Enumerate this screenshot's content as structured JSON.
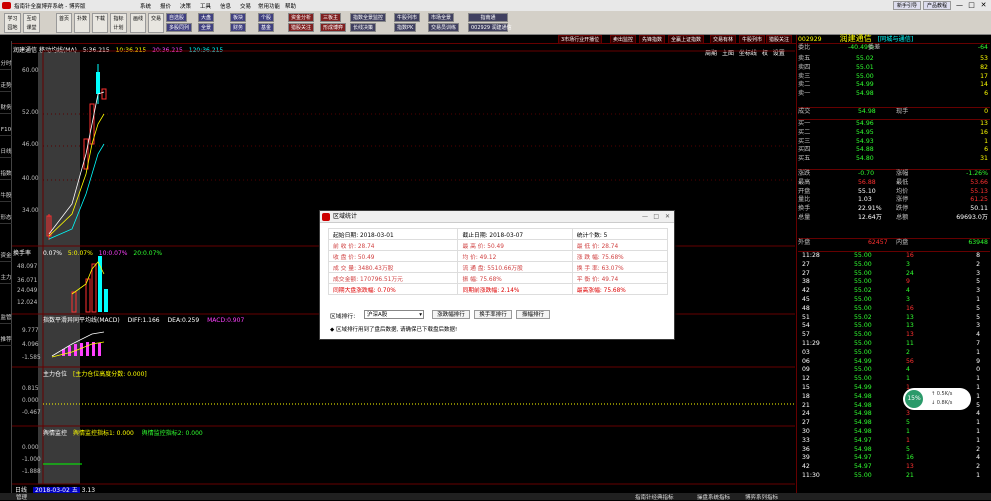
{
  "titlebar": {
    "app_title": "指南针全赢博弈系统 - 博弈版",
    "menus": [
      "系统",
      "报价",
      "决策",
      "工具",
      "信息",
      "交易",
      "常用功能",
      "帮助"
    ],
    "right_buttons": [
      "新手引导",
      "产品教程"
    ],
    "min": "—",
    "max": "□",
    "close": "✕"
  },
  "toolbar": {
    "big_buttons": [
      "学习\n园地",
      "互动\n课堂",
      "首页",
      "扑数",
      "下载",
      "指标\n计划",
      "画线",
      "交易"
    ],
    "mid_row1": [
      "自选股",
      "大盘",
      "板块",
      "个股",
      "资金分析",
      "三板主",
      "指数全景监控",
      "牛股列市",
      "市场全景",
      "指南通"
    ],
    "mid_row2": [
      "多股同列",
      "全景",
      "财务",
      "基金",
      "猎股关注",
      "形成博弈",
      "长线决策",
      "指数PK",
      "交易员训练",
      "002929 润建通信"
    ],
    "right_tabs": [
      "3市场行业开播位",
      "卖出监控",
      "先锋指数",
      "全赢上证指数",
      "交易有林",
      "牛股列市",
      "猎股关注"
    ]
  },
  "left_tabs": [
    "分时",
    "走势",
    "财务",
    "F10",
    "日线",
    "指数",
    "牛股",
    "形态",
    "资金",
    "主力",
    "监管",
    "推荐"
  ],
  "chart": {
    "stock_name": "润建通信",
    "period_label": "移动均线(MA)",
    "ma_labels": [
      {
        "text": "5:36.215",
        "color": "#ffffff"
      },
      {
        "text": "10:36.215",
        "color": "#ffff00"
      },
      {
        "text": "20:36.215",
        "color": "#ff40ff"
      },
      {
        "text": "120:36.215",
        "color": "#00ffff"
      }
    ],
    "top_right": [
      "周期",
      "主图",
      "坐标线",
      "权",
      "设置"
    ],
    "y_price": [
      "60.00",
      "52.00",
      "46.00",
      "40.00",
      "34.00"
    ],
    "turnover": {
      "label": "换手率",
      "v1": "0.07%",
      "v2": "5:0.07%",
      "v3": "10:0.07%",
      "v4": "20:0.07%",
      "y": [
        "48.097",
        "36.071",
        "24.049",
        "12.024"
      ]
    },
    "macd": {
      "label": "指数平滑异同平均线(MACD)",
      "diff": "DIFF:1.166",
      "dea": "DEA:0.259",
      "macd": "MACD:0.907",
      "y": [
        "9.777",
        "4.096",
        "-1.585"
      ]
    },
    "zlcw": {
      "label": "主力仓位",
      "sub": "[主力仓位高度分数: 0.000]",
      "y": [
        "0.815",
        "0.000",
        "-0.467"
      ]
    },
    "yqjk": {
      "label": "舆情监控",
      "sub1": "舆情监控指标1: 0.000",
      "sub2": "舆情监控指标2: 0.000",
      "y": [
        "0.000",
        "-1.000",
        "-1.888"
      ]
    },
    "date_label": "日线",
    "date_value": "2018-03-02",
    "date_weekday": "五",
    "date_price": "3.13"
  },
  "quote": {
    "code": "002929",
    "name": "润建通信",
    "tag": "[同城与通信]",
    "weibi_label": "委比",
    "weibi": "-40.49%",
    "weicha_label": "委差",
    "weicha": "-64",
    "sell": [
      {
        "l": "卖五",
        "p": "55.02",
        "v": "53"
      },
      {
        "l": "卖四",
        "p": "55.01",
        "v": "82"
      },
      {
        "l": "卖三",
        "p": "55.00",
        "v": "17"
      },
      {
        "l": "卖二",
        "p": "54.99",
        "v": "14"
      },
      {
        "l": "卖一",
        "p": "54.98",
        "v": "6"
      }
    ],
    "chengjiao_label": "成交",
    "chengjiao": "54.98",
    "xianshou_label": "现手",
    "xianshou": "0",
    "buy": [
      {
        "l": "买一",
        "p": "54.96",
        "v": "13"
      },
      {
        "l": "买二",
        "p": "54.95",
        "v": "16"
      },
      {
        "l": "买三",
        "p": "54.93",
        "v": "1"
      },
      {
        "l": "买四",
        "p": "54.88",
        "v": "6"
      },
      {
        "l": "买五",
        "p": "54.80",
        "v": "31"
      }
    ],
    "stats": [
      {
        "l1": "涨跌",
        "v1": "-0.70",
        "l2": "涨幅",
        "v2": "-1.26%"
      },
      {
        "l1": "最高",
        "v1": "56.88",
        "l2": "最低",
        "v2": "53.66"
      },
      {
        "l1": "开盘",
        "v1": "55.10",
        "l2": "均价",
        "v2": "55.13"
      },
      {
        "l1": "量比",
        "v1": "1.03",
        "l2": "涨停",
        "v2": "61.25"
      },
      {
        "l1": "换手",
        "v1": "22.91%",
        "l2": "跌停",
        "v2": "50.11"
      },
      {
        "l1": "总量",
        "v1": "12.64万",
        "l2": "总额",
        "v2": "69693.0万"
      }
    ],
    "waipan_label": "外盘",
    "waipan": "62457",
    "neipan_label": "内盘",
    "neipan": "63948",
    "ticks": [
      {
        "t": "11:28",
        "p": "55.00",
        "v": "16",
        "n": "8"
      },
      {
        "t": "27",
        "p": "55.00",
        "v": "3",
        "n": "2"
      },
      {
        "t": "27",
        "p": "55.00",
        "v": "24",
        "n": "3"
      },
      {
        "t": "38",
        "p": "55.00",
        "v": "9",
        "n": "5"
      },
      {
        "t": "42",
        "p": "55.02",
        "v": "4",
        "n": "3"
      },
      {
        "t": "45",
        "p": "55.00",
        "v": "3",
        "n": "1"
      },
      {
        "t": "48",
        "p": "55.00",
        "v": "16",
        "n": "5"
      },
      {
        "t": "51",
        "p": "55.02",
        "v": "13",
        "n": "5"
      },
      {
        "t": "54",
        "p": "55.00",
        "v": "13",
        "n": "3"
      },
      {
        "t": "57",
        "p": "55.00",
        "v": "13",
        "n": "4"
      },
      {
        "t": "11:29",
        "p": "55.00",
        "v": "11",
        "n": "7"
      },
      {
        "t": "03",
        "p": "55.00",
        "v": "2",
        "n": "1"
      },
      {
        "t": "06",
        "p": "54.99",
        "v": "56",
        "n": "9"
      },
      {
        "t": "09",
        "p": "55.00",
        "v": "4",
        "n": "0"
      },
      {
        "t": "12",
        "p": "55.00",
        "v": "1",
        "n": "1"
      },
      {
        "t": "15",
        "p": "54.99",
        "v": "1",
        "n": "1"
      },
      {
        "t": "18",
        "p": "54.98",
        "v": "2",
        "n": "1"
      },
      {
        "t": "21",
        "p": "54.98",
        "v": "15",
        "n": "5"
      },
      {
        "t": "24",
        "p": "54.98",
        "v": "3",
        "n": "4"
      },
      {
        "t": "27",
        "p": "54.98",
        "v": "5",
        "n": "1"
      },
      {
        "t": "30",
        "p": "54.98",
        "v": "1",
        "n": "1"
      },
      {
        "t": "33",
        "p": "54.97",
        "v": "1",
        "n": "1"
      },
      {
        "t": "36",
        "p": "54.98",
        "v": "5",
        "n": "2"
      },
      {
        "t": "39",
        "p": "54.97",
        "v": "16",
        "n": "4"
      },
      {
        "t": "42",
        "p": "54.97",
        "v": "13",
        "n": "2"
      },
      {
        "t": "11:30",
        "p": "55.00",
        "v": "21",
        "n": "1"
      }
    ],
    "net_pct": "15%",
    "net_up": "0.5K/s",
    "net_down": "0.8K/s"
  },
  "dialog": {
    "title": "区域统计",
    "close": "✕",
    "min": "—",
    "max": "□",
    "rows": [
      [
        "起始日期: 2018-03-01",
        "截止日期: 2018-03-07",
        "统计个数: 5"
      ],
      [
        "前 收 价: 28.74",
        "最 高 价: 50.49",
        "最 低 价: 28.74"
      ],
      [
        "收 盘 价: 50.49",
        "均    价: 49.12",
        "涨 跌 幅: 75.68%"
      ],
      [
        "成 交 量: 3480.43万股",
        "流 通 盘: 5510.66万股",
        "换 手 率: 63.07%"
      ],
      [
        "成交金额: 170796.51万元",
        "振    幅: 75.68%",
        "平 衡 价: 49.74"
      ],
      [
        "同期大盘涨跌幅: 0.70%",
        "同期前涨跌幅: 2.14%",
        "最高涨幅: 75.68%"
      ]
    ],
    "rank_label": "区域排行:",
    "rank_select": "沪深A股",
    "btn1": "涨跌幅排行",
    "btn2": "换手率排行",
    "btn3": "振幅排行",
    "note": "◆ 区域排行用到了盘后数据, 请确保已下载盘后数据!"
  },
  "bottom": {
    "left": "管理",
    "items": [
      "指南针经典指标",
      "操盘系统指标",
      "博弈系列指标"
    ]
  },
  "colors": {
    "up": "#ff3030",
    "down": "#30ff30",
    "bg": "#000000",
    "frame": "#660000"
  }
}
